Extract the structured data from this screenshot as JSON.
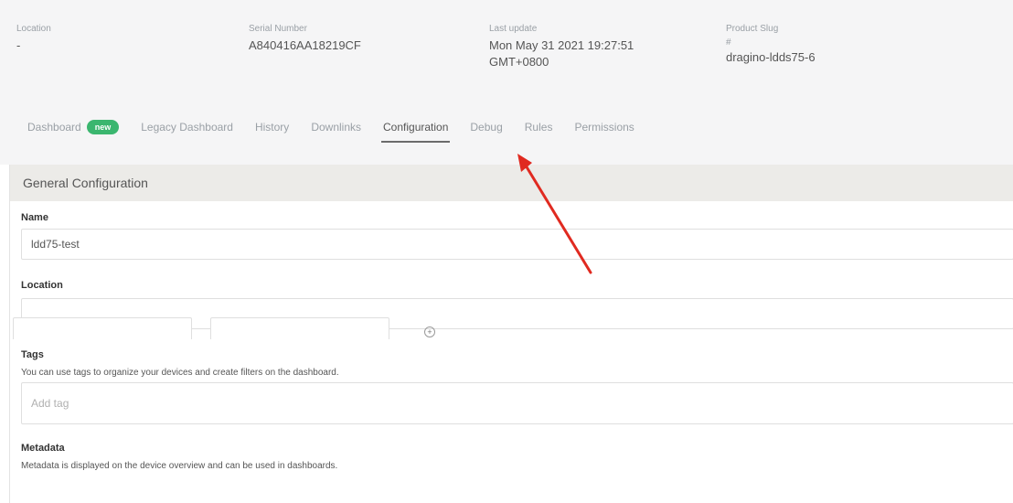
{
  "header": {
    "location": {
      "label": "Location",
      "value": "-"
    },
    "serial": {
      "label": "Serial Number",
      "value": "A840416AA18219CF"
    },
    "last_update": {
      "label": "Last update",
      "value_line1": "Mon May 31 2021 19:27:51",
      "value_line2": "GMT+0800"
    },
    "product_slug": {
      "label": "Product Slug",
      "sub": "#",
      "value": "dragino-ldds75-6"
    }
  },
  "tabs": {
    "dashboard": {
      "label": "Dashboard",
      "badge": "new"
    },
    "legacy_dashboard": {
      "label": "Legacy Dashboard"
    },
    "history": {
      "label": "History"
    },
    "downlinks": {
      "label": "Downlinks"
    },
    "configuration": {
      "label": "Configuration",
      "active": true
    },
    "debug": {
      "label": "Debug"
    },
    "rules": {
      "label": "Rules"
    },
    "permissions": {
      "label": "Permissions"
    }
  },
  "panel": {
    "title": "General Configuration",
    "name": {
      "label": "Name",
      "value": "ldd75-test"
    },
    "location": {
      "label": "Location",
      "value": ""
    },
    "tags": {
      "label": "Tags",
      "helper": "You can use tags to organize your devices and create filters on the dashboard.",
      "placeholder": "Add tag"
    },
    "metadata": {
      "label": "Metadata",
      "helper": "Metadata is displayed on the device overview and can be used in dashboards."
    }
  },
  "annotation": {
    "arrow_color": "#e02a20"
  },
  "colors": {
    "badge": "#3bb66f",
    "header_bg": "#f5f5f6",
    "panel_head_bg": "#ecebe8"
  }
}
